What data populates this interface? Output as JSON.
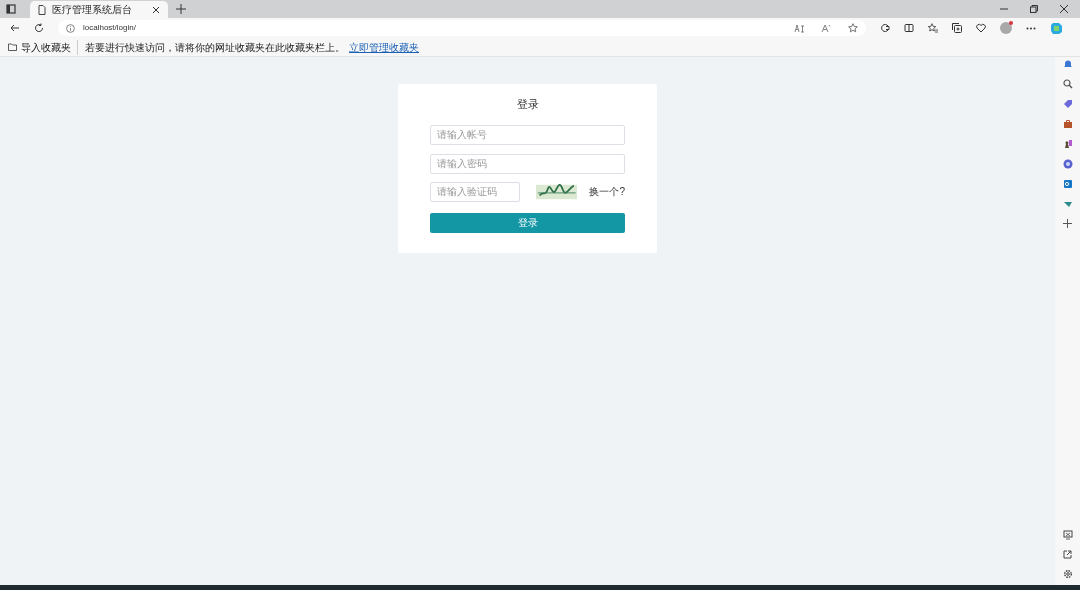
{
  "browser": {
    "tab_title": "医疗管理系统后台",
    "url": "localhost/login/",
    "bookmarks_bar": {
      "import_label": "导入收藏夹",
      "hint": "若要进行快速访问，请将你的网址收藏夹在此收藏夹栏上。",
      "link": "立即管理收藏夹"
    }
  },
  "login": {
    "title": "登录",
    "fields": [
      {
        "placeholder": "请输入帐号"
      },
      {
        "placeholder": "请输入密码"
      }
    ],
    "captcha": {
      "placeholder": "请输入验证码",
      "refresh_link": "换一个?"
    },
    "submit": "登录"
  }
}
